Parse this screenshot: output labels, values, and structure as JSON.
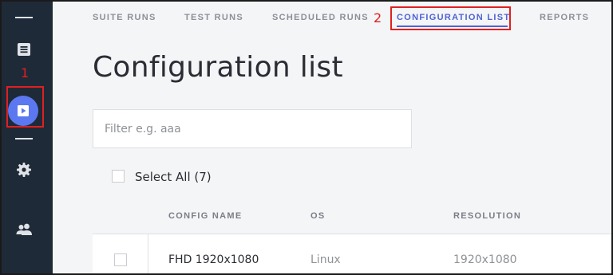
{
  "annotations": {
    "sidebar_marker": "1",
    "tab_marker": "2"
  },
  "sidebar": {
    "items": [
      {
        "icon": "list-icon"
      },
      {
        "icon": "play-icon",
        "active": true
      },
      {
        "icon": "gear-icon"
      },
      {
        "icon": "users-icon"
      }
    ]
  },
  "tabs": [
    {
      "label": "SUITE RUNS"
    },
    {
      "label": "TEST RUNS"
    },
    {
      "label": "SCHEDULED RUNS"
    },
    {
      "label": "CONFIGURATION LIST",
      "active": true
    },
    {
      "label": "REPORTS"
    }
  ],
  "main": {
    "title": "Configuration list",
    "filter": {
      "placeholder": "Filter e.g. aaa",
      "value": ""
    },
    "select_all_label": "Select All (7)",
    "table": {
      "columns": [
        "CONFIG NAME",
        "OS",
        "RESOLUTION"
      ],
      "rows": [
        {
          "config_name": "FHD 1920x1080",
          "os": "Linux",
          "resolution": "1920x1080"
        }
      ]
    }
  },
  "colors": {
    "sidebar_bg": "#1f2a38",
    "accent": "#4e63d6",
    "active_icon_bg": "#5b78f0",
    "annotation": "#e02020"
  }
}
